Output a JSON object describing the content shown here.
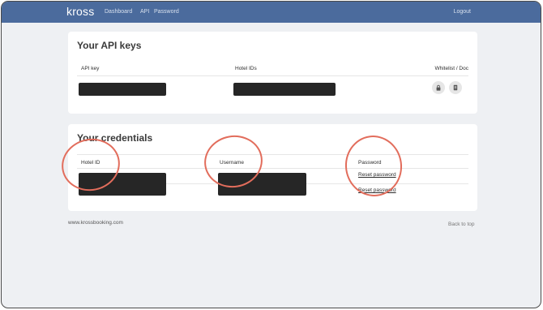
{
  "nav": {
    "logo": "kross",
    "links": [
      "Dashboard",
      "API",
      "Password"
    ],
    "logout": "Logout"
  },
  "api_keys": {
    "title": "Your API keys",
    "columns": [
      "API key",
      "Hotel IDs",
      "Whitelist / Doc"
    ],
    "icons": [
      "lock-icon",
      "document-icon"
    ]
  },
  "credentials": {
    "title": "Your credentials",
    "columns": [
      "Hotel ID",
      "Username",
      "Password"
    ],
    "reset_links": [
      "Reset password",
      "Reset password"
    ]
  },
  "footer": {
    "site": "www.krossbooking.com",
    "back_to_top": "Back to top"
  },
  "colors": {
    "nav_bg": "#4b6b9d",
    "annotation_circle": "#e26d5c",
    "redaction": "#262626"
  }
}
